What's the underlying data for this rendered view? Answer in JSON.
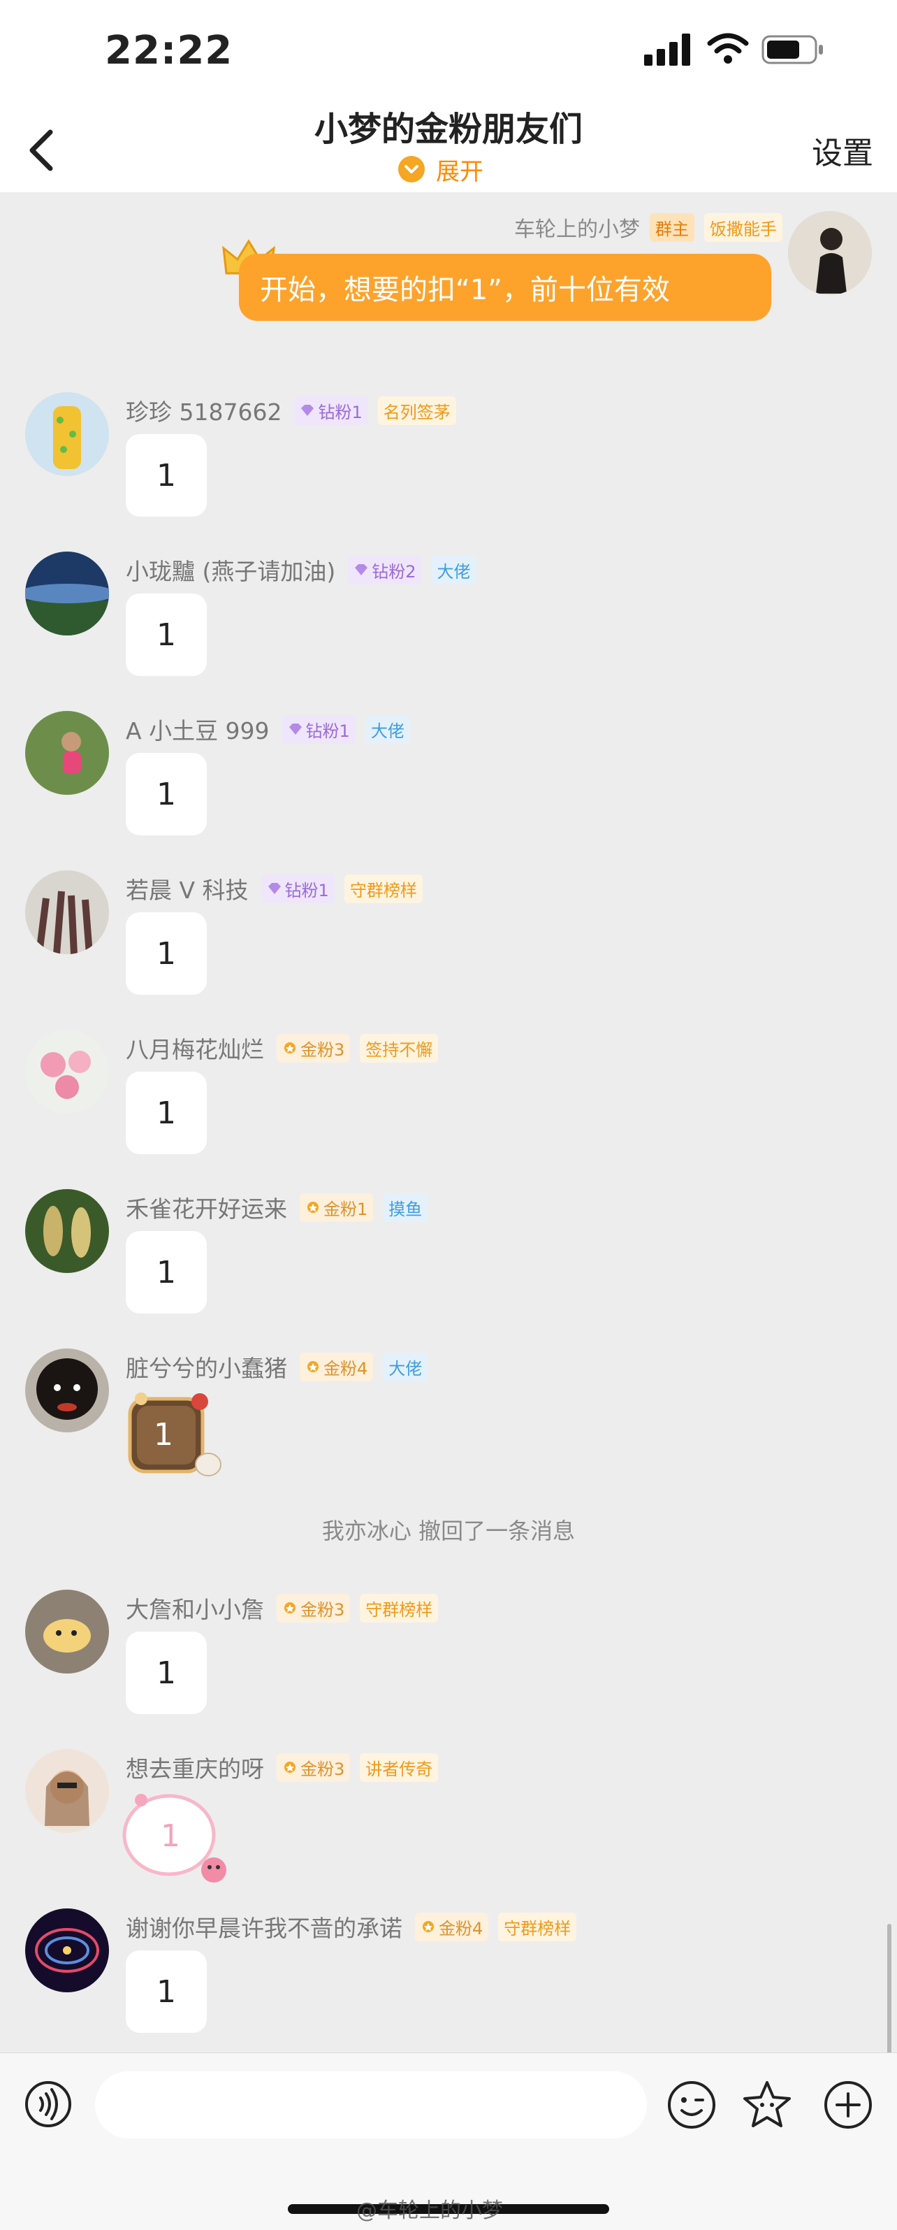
{
  "status": {
    "time": "22:22"
  },
  "header": {
    "title": "小梦的金粉朋友们",
    "expand_label": "展开",
    "settings_label": "设置"
  },
  "own_message": {
    "name": "车轮上的小梦",
    "tags": [
      "群主",
      "饭撒能手"
    ],
    "text": "开始，想要的扣“1”，前十位有效"
  },
  "messages": [
    {
      "name": "珍珍 5187662",
      "fan_badge": "钻粉1",
      "fan_type": "diamond",
      "tag": "名列签茅",
      "tag_color": "orange",
      "text": "1",
      "bubble": "plain"
    },
    {
      "name": "小珑黸 (燕子请加油)",
      "fan_badge": "钻粉2",
      "fan_type": "diamond",
      "tag": "大佬",
      "tag_color": "blue",
      "text": "1",
      "bubble": "plain"
    },
    {
      "name": "A 小土豆 999",
      "fan_badge": "钻粉1",
      "fan_type": "diamond",
      "tag": "大佬",
      "tag_color": "blue",
      "text": "1",
      "bubble": "plain"
    },
    {
      "name": "若晨 V 科技",
      "fan_badge": "钻粉1",
      "fan_type": "diamond",
      "tag": "守群榜样",
      "tag_color": "orange",
      "text": "1",
      "bubble": "plain"
    },
    {
      "name": "八月梅花灿烂",
      "fan_badge": "金粉3",
      "fan_type": "gold",
      "tag": "签持不懈",
      "tag_color": "orange",
      "text": "1",
      "bubble": "plain"
    },
    {
      "name": "禾雀花开好运来",
      "fan_badge": "金粉1",
      "fan_type": "gold",
      "tag": "摸鱼",
      "tag_color": "blue",
      "text": "1",
      "bubble": "plain"
    },
    {
      "name": "脏兮兮的小蠢猪",
      "fan_badge": "金粉4",
      "fan_type": "gold",
      "tag": "大佬",
      "tag_color": "blue",
      "text": "1",
      "bubble": "brown"
    },
    {
      "name": "大詹和小小詹",
      "fan_badge": "金粉3",
      "fan_type": "gold",
      "tag": "守群榜样",
      "tag_color": "orange",
      "text": "1",
      "bubble": "plain"
    },
    {
      "name": "想去重庆的呀",
      "fan_badge": "金粉3",
      "fan_type": "gold",
      "tag": "讲者传奇",
      "tag_color": "orange",
      "text": "1",
      "bubble": "pink"
    },
    {
      "name": "谢谢你早晨许我不啬的承诺",
      "fan_badge": "金粉4",
      "fan_type": "gold",
      "tag": "守群榜样",
      "tag_color": "orange",
      "text": "1",
      "bubble": "plain"
    }
  ],
  "system_notice": "我亦冰心 撤回了一条消息",
  "input": {
    "placeholder": ""
  },
  "watermark": "@车轮上的小梦",
  "colors": {
    "accent": "#fda32c",
    "expand": "#ff8a00",
    "background": "#ededed"
  }
}
